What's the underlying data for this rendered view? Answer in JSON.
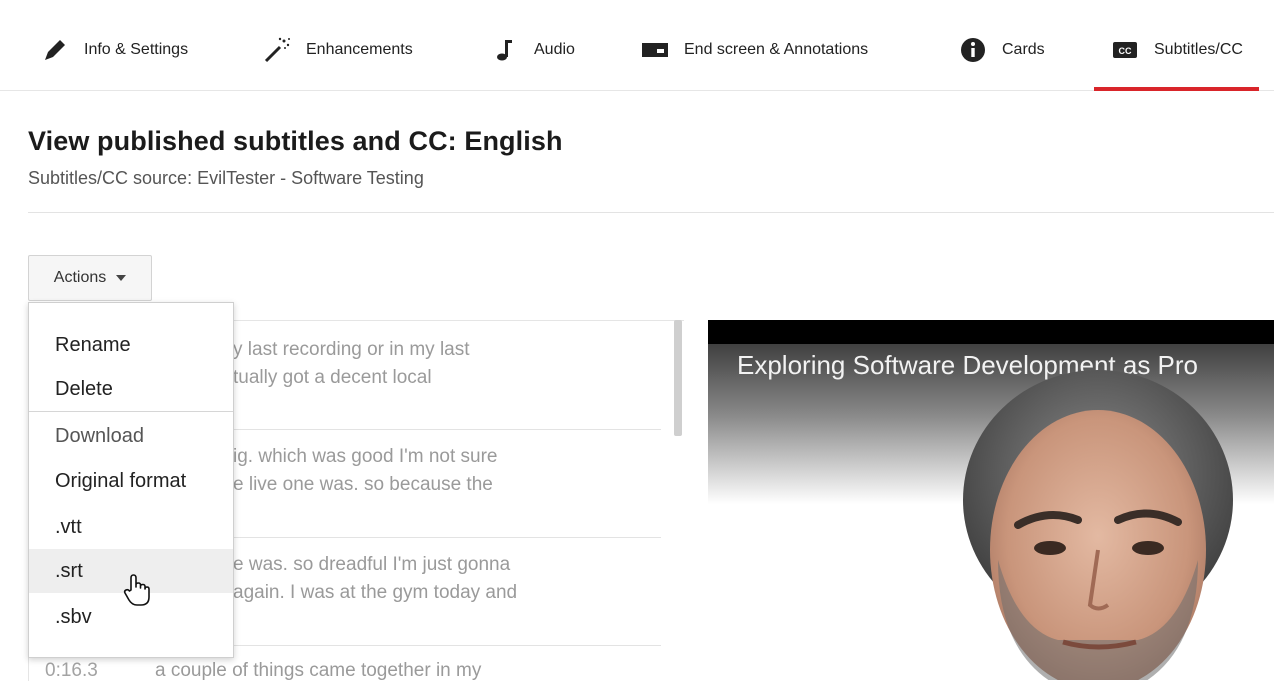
{
  "tabs": [
    {
      "label": "Info & Settings",
      "icon": "pencil-icon"
    },
    {
      "label": "Enhancements",
      "icon": "magic-wand-icon"
    },
    {
      "label": "Audio",
      "icon": "music-note-icon"
    },
    {
      "label": "End screen & Annotations",
      "icon": "end-screen-icon"
    },
    {
      "label": "Cards",
      "icon": "info-circle-icon"
    },
    {
      "label": "Subtitles/CC",
      "icon": "cc-icon",
      "active": true
    }
  ],
  "page": {
    "title": "View published subtitles and CC: English",
    "subtitle": "Subtitles/CC source: EvilTester - Software Testing"
  },
  "actions": {
    "label": "Actions"
  },
  "menu": {
    "items": [
      {
        "label": "Rename"
      },
      {
        "label": "Delete"
      },
      {
        "label": "Download"
      },
      {
        "label": "Original format"
      },
      {
        "label": ".vtt"
      },
      {
        "label": ".srt",
        "hovered": true
      },
      {
        "label": ".sbv"
      }
    ]
  },
  "captions": {
    "rows": [
      {
        "line1": "y last recording or in my last",
        "line2": "tually got a decent local"
      },
      {
        "line1": "ig. which was good I'm not sure",
        "line2": "e live one was. so because the"
      },
      {
        "line1": "e was. so dreadful I'm just gonna",
        "line2": "again. I was at the gym today and"
      },
      {
        "time": "0:16.3",
        "line1": "a couple of things came together in my"
      }
    ]
  },
  "video": {
    "title": "Exploring Software Development as Pro"
  },
  "colors": {
    "accent": "#d9252a"
  }
}
